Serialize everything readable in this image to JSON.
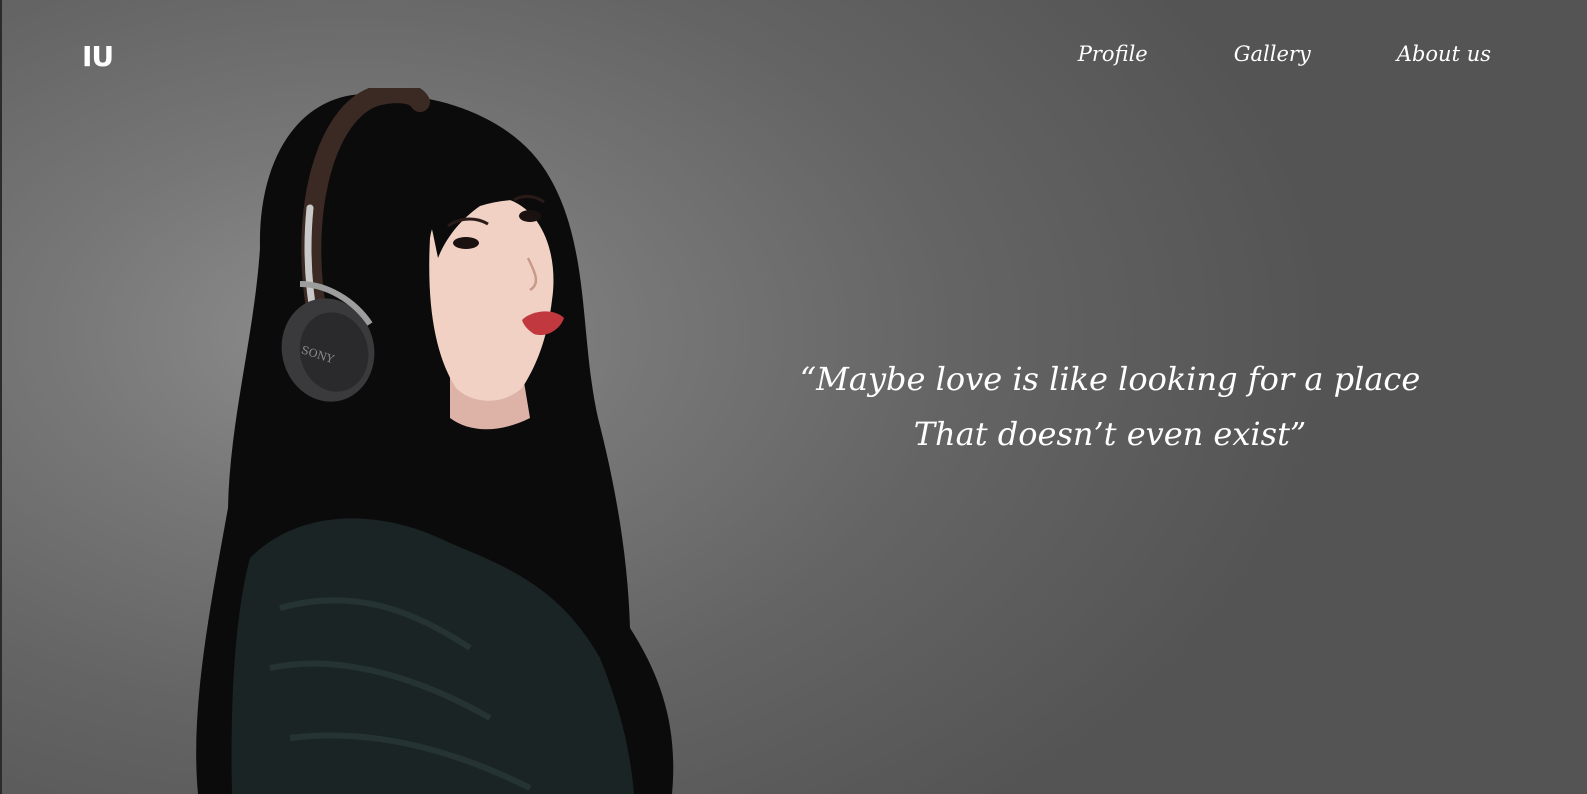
{
  "header": {
    "logo": "IU",
    "nav": [
      {
        "label": "Profile"
      },
      {
        "label": "Gallery"
      },
      {
        "label": "About us"
      }
    ]
  },
  "hero": {
    "quote_line1": "“Maybe love is like looking for a place",
    "quote_line2": "That doesn’t even exist”",
    "headphone_brand": "SONY"
  },
  "colors": {
    "background_light": "#8d8d8d",
    "background_dark": "#545454",
    "text": "#ffffff"
  }
}
